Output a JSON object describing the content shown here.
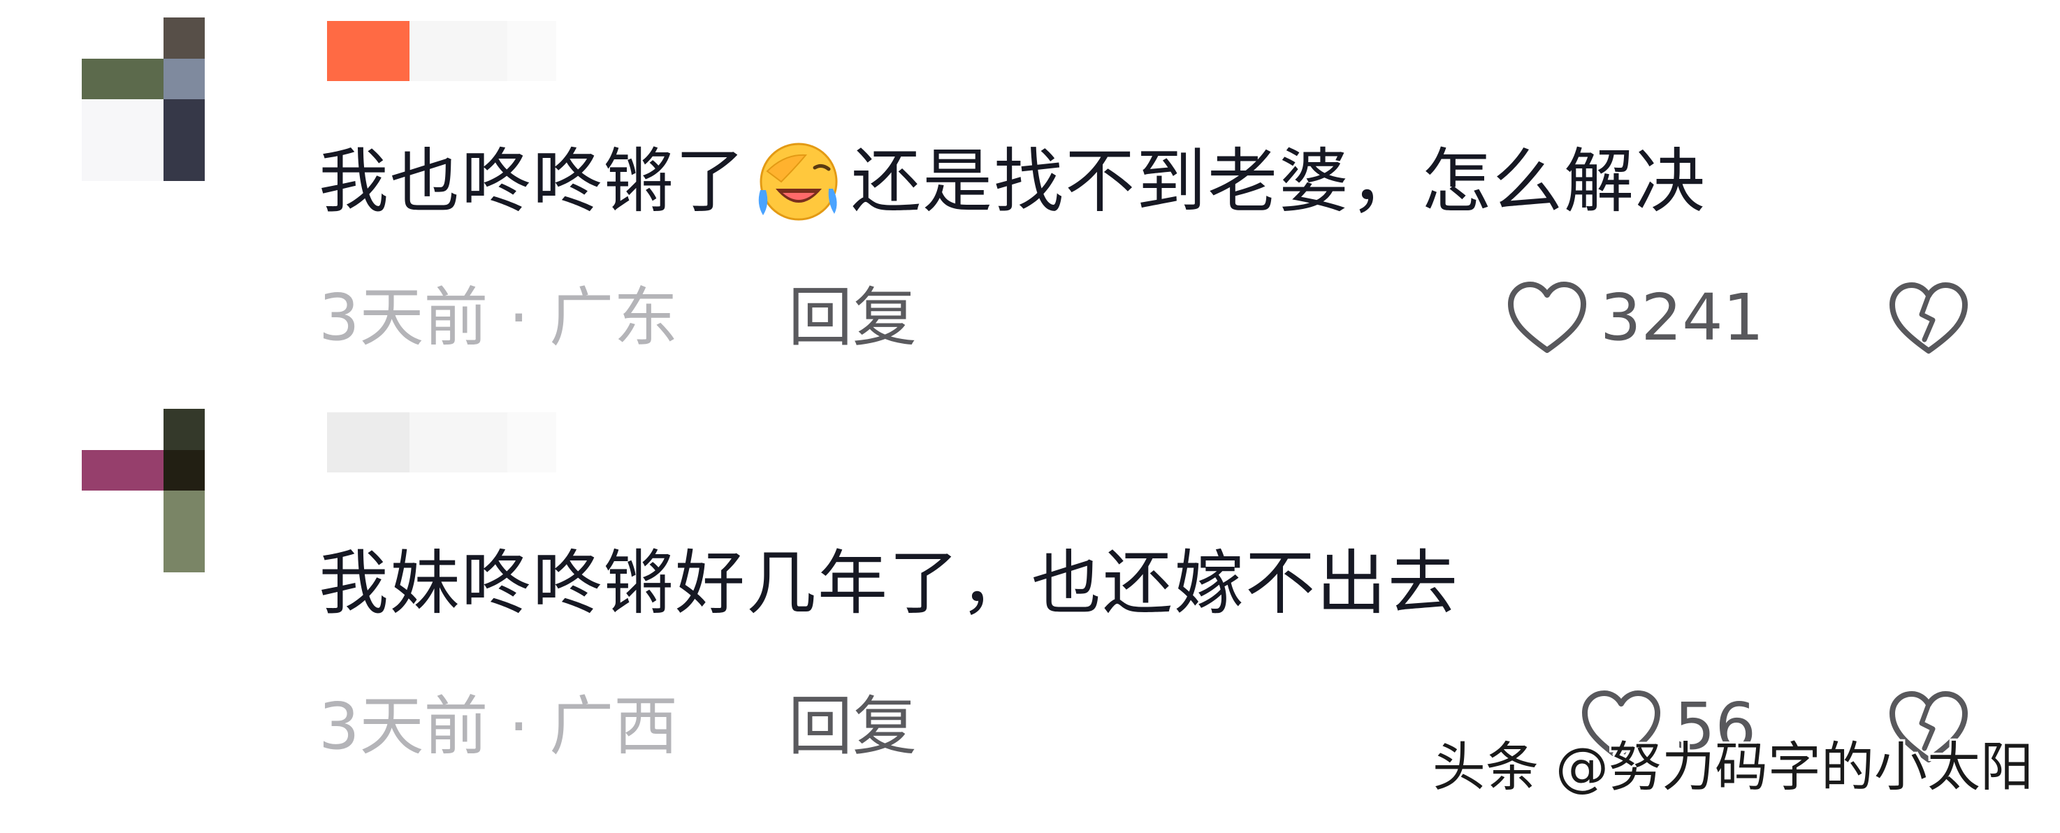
{
  "colors": {
    "text_primary": "#161823",
    "text_secondary": "#b4b4b8",
    "action_text": "#5a5a5e",
    "username_accent": "#ff6a44"
  },
  "comments": [
    {
      "text_before_emoji": "我也咚咚锵了",
      "emoji": "facepalm-laughing-emoji",
      "text_after_emoji": "还是找不到老婆，怎么解决",
      "time": "3天前",
      "location": "广东",
      "reply_label": "回复",
      "like_count": "3241",
      "avatar_colors": [
        "#ffffff",
        "#ffffff",
        "#574f48",
        "#ffffff",
        "#5c6a4c",
        "#5c6a4c",
        "#7f8a9e",
        "#ffffff",
        "#f7f7f9",
        "#f7f7f9",
        "#363848",
        "#ffffff",
        "#f7f7f9",
        "#f7f7f9",
        "#363848",
        "#ffffff"
      ]
    },
    {
      "text": "我妹咚咚锵好几年了，也还嫁不出去",
      "time": "3天前",
      "location": "广西",
      "reply_label": "回复",
      "like_count": "56",
      "avatar_colors": [
        "#ffffff",
        "#ffffff",
        "#34392a",
        "#ffffff",
        "#963f6c",
        "#963f6c",
        "#221f13",
        "#ffffff",
        "#ffffff",
        "#ffffff",
        "#7a8566",
        "#ffffff",
        "#ffffff",
        "#ffffff",
        "#7a8566",
        "#ffffff"
      ]
    }
  ],
  "meta_separator": " · ",
  "watermark": "头条 @努力码字的小太阳"
}
